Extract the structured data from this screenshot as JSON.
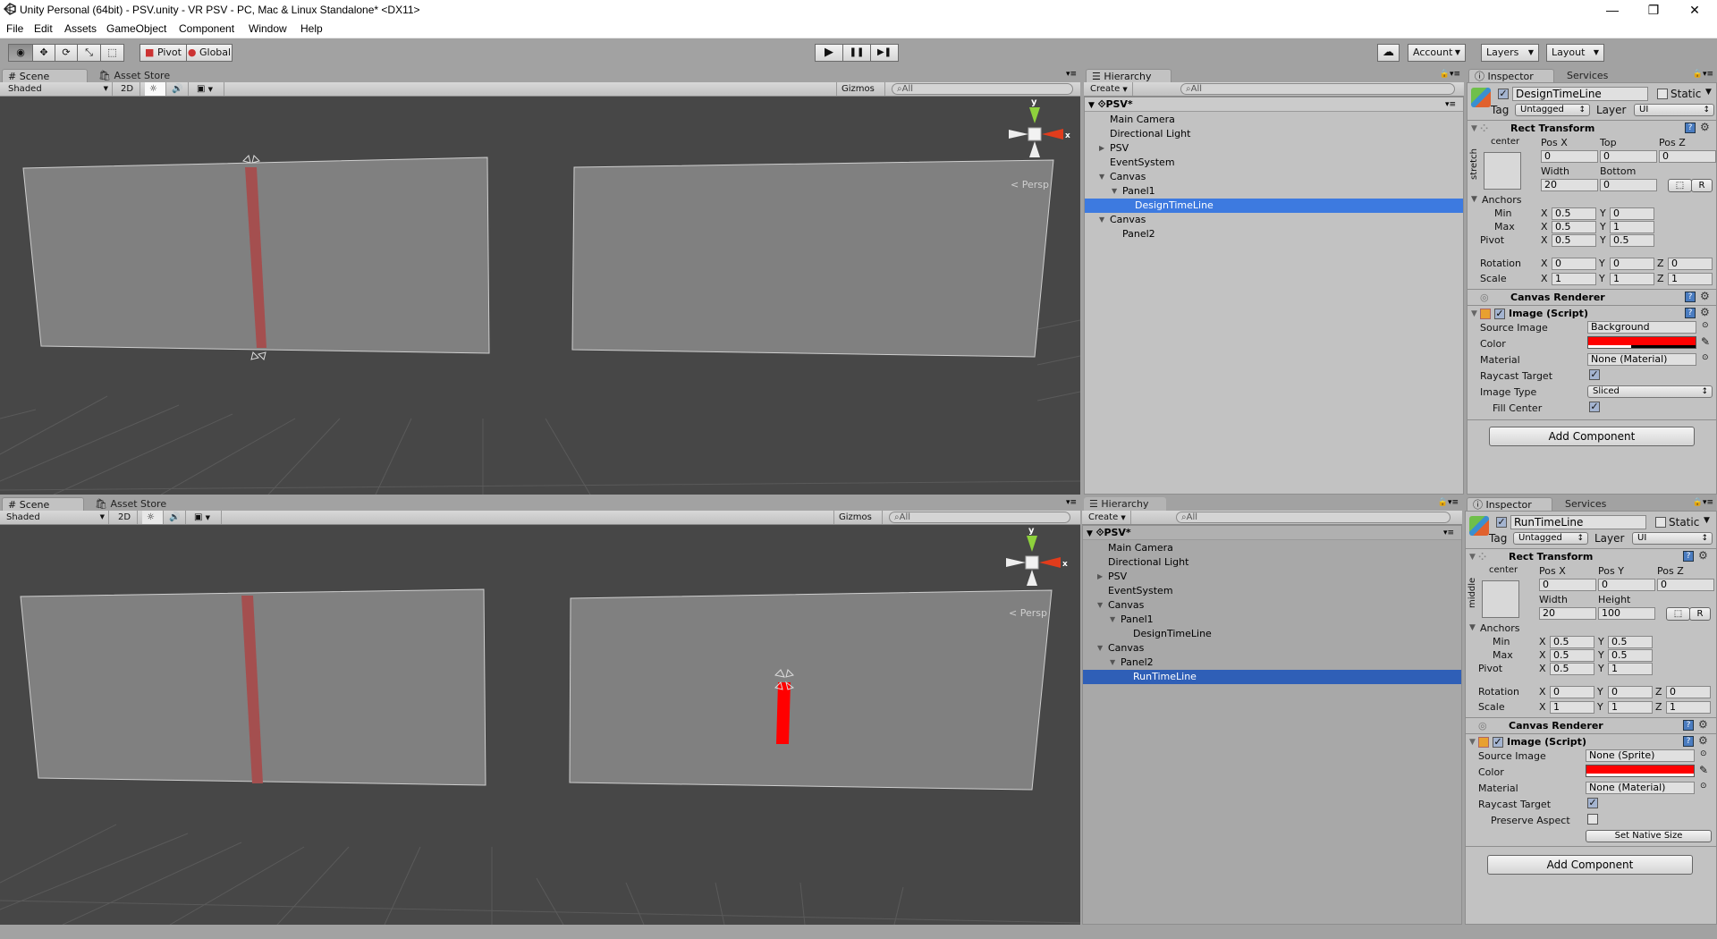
{
  "window": {
    "title": "Unity Personal (64bit) - PSV.unity - VR PSV - PC, Mac & Linux Standalone* <DX11>",
    "minimize_icon": "—",
    "maximize_icon": "❐",
    "close_icon": "✕"
  },
  "menu": [
    "File",
    "Edit",
    "Assets",
    "GameObject",
    "Component",
    "Window",
    "Help"
  ],
  "toolbar": {
    "tools": [
      "view-tool",
      "move-tool",
      "rotate-tool",
      "scale-tool",
      "rect-tool"
    ],
    "tool_glyphs": [
      "◉",
      "✥",
      "⟳",
      "⤡",
      "⬚"
    ],
    "pivot": "Pivot",
    "global": "Global",
    "play": "▶",
    "pause": "❚❚",
    "step": "▶❚",
    "collab_icon": "☁",
    "account": "Account",
    "layers": "Layers",
    "layout": "Layout"
  },
  "scene_panels": [
    {
      "tabs": [
        "Scene",
        "Asset Store"
      ],
      "shading": "Shaded",
      "mode_2d": "2D",
      "light_icon": "☼",
      "audio_icon": "🔊",
      "fx_icon": "▣",
      "gizmos": "Gizmos",
      "search_placeholder": "All",
      "persp_label": "Persp"
    },
    {
      "tabs": [
        "Scene",
        "Asset Store"
      ],
      "shading": "Shaded",
      "mode_2d": "2D",
      "light_icon": "☼",
      "audio_icon": "🔊",
      "fx_icon": "▣",
      "gizmos": "Gizmos",
      "search_placeholder": "All",
      "persp_label": "Persp"
    }
  ],
  "hierarchies": [
    {
      "tab": "Hierarchy",
      "create": "Create",
      "search_placeholder": "All",
      "scene": "PSV*",
      "rows": [
        {
          "label": "Main Camera",
          "depth": 0,
          "arrow": ""
        },
        {
          "label": "Directional Light",
          "depth": 0,
          "arrow": ""
        },
        {
          "label": "PSV",
          "depth": 0,
          "arrow": "▶"
        },
        {
          "label": "EventSystem",
          "depth": 0,
          "arrow": ""
        },
        {
          "label": "Canvas",
          "depth": 0,
          "arrow": "▼"
        },
        {
          "label": "Panel1",
          "depth": 1,
          "arrow": "▼"
        },
        {
          "label": "DesignTimeLine",
          "depth": 2,
          "arrow": "",
          "selected": true
        },
        {
          "label": "Canvas",
          "depth": 0,
          "arrow": "▼"
        },
        {
          "label": "Panel2",
          "depth": 1,
          "arrow": ""
        }
      ]
    },
    {
      "tab": "Hierarchy",
      "create": "Create",
      "search_placeholder": "All",
      "scene": "PSV*",
      "rows": [
        {
          "label": "Main Camera",
          "depth": 0,
          "arrow": ""
        },
        {
          "label": "Directional Light",
          "depth": 0,
          "arrow": ""
        },
        {
          "label": "PSV",
          "depth": 0,
          "arrow": "▶"
        },
        {
          "label": "EventSystem",
          "depth": 0,
          "arrow": ""
        },
        {
          "label": "Canvas",
          "depth": 0,
          "arrow": "▼"
        },
        {
          "label": "Panel1",
          "depth": 1,
          "arrow": "▼"
        },
        {
          "label": "DesignTimeLine",
          "depth": 2,
          "arrow": ""
        },
        {
          "label": "Canvas",
          "depth": 0,
          "arrow": "▼"
        },
        {
          "label": "Panel2",
          "depth": 1,
          "arrow": "▼"
        },
        {
          "label": "RunTimeLine",
          "depth": 2,
          "arrow": "",
          "selected": true
        }
      ]
    }
  ],
  "inspectors": [
    {
      "tabs": [
        "Inspector",
        "Services"
      ],
      "object_name": "DesignTimeLine",
      "active": true,
      "static_label": "Static",
      "static": false,
      "tag_label": "Tag",
      "tag": "Untagged",
      "layer_label": "Layer",
      "layer": "UI",
      "rect_transform": {
        "title": "Rect Transform",
        "anchor_h": "center",
        "anchor_v": "stretch",
        "headers": [
          "Pos X",
          "Top",
          "Pos Z"
        ],
        "values_row1": [
          "0",
          "0",
          "0"
        ],
        "headers2": [
          "Width",
          "Bottom"
        ],
        "values_row2": [
          "20",
          "0"
        ],
        "blueprint_btn": "⬚",
        "raw_btn": "R",
        "anchors_label": "Anchors",
        "min_label": "Min",
        "min": [
          "0.5",
          "0"
        ],
        "max_label": "Max",
        "max": [
          "0.5",
          "1"
        ],
        "pivot_label": "Pivot",
        "pivot": [
          "0.5",
          "0.5"
        ],
        "rotation_label": "Rotation",
        "rotation": [
          "0",
          "0",
          "0"
        ],
        "scale_label": "Scale",
        "scale": [
          "1",
          "1",
          "1"
        ]
      },
      "canvas_renderer": "Canvas Renderer",
      "image": {
        "title": "Image (Script)",
        "source_label": "Source Image",
        "source": "Background",
        "color_label": "Color",
        "color": "#ff0000",
        "alpha": 0.4,
        "material_label": "Material",
        "material": "None (Material)",
        "raycast_label": "Raycast Target",
        "raycast": true,
        "type_label": "Image Type",
        "type": "Sliced",
        "fill_label": "Fill Center",
        "fill": true
      },
      "add_component": "Add Component"
    },
    {
      "tabs": [
        "Inspector",
        "Services"
      ],
      "object_name": "RunTimeLine",
      "active": true,
      "static_label": "Static",
      "static": false,
      "tag_label": "Tag",
      "tag": "Untagged",
      "layer_label": "Layer",
      "layer": "UI",
      "rect_transform": {
        "title": "Rect Transform",
        "anchor_h": "center",
        "anchor_v": "middle",
        "headers": [
          "Pos X",
          "Pos Y",
          "Pos Z"
        ],
        "values_row1": [
          "0",
          "0",
          "0"
        ],
        "headers2": [
          "Width",
          "Height"
        ],
        "values_row2": [
          "20",
          "100"
        ],
        "blueprint_btn": "⬚",
        "raw_btn": "R",
        "anchors_label": "Anchors",
        "min_label": "Min",
        "min": [
          "0.5",
          "0.5"
        ],
        "max_label": "Max",
        "max": [
          "0.5",
          "0.5"
        ],
        "pivot_label": "Pivot",
        "pivot": [
          "0.5",
          "1"
        ],
        "rotation_label": "Rotation",
        "rotation": [
          "0",
          "0",
          "0"
        ],
        "scale_label": "Scale",
        "scale": [
          "1",
          "1",
          "1"
        ]
      },
      "canvas_renderer": "Canvas Renderer",
      "image": {
        "title": "Image (Script)",
        "source_label": "Source Image",
        "source": "None (Sprite)",
        "color_label": "Color",
        "color": "#ff0000",
        "alpha": 1.0,
        "material_label": "Material",
        "material": "None (Material)",
        "raycast_label": "Raycast Target",
        "raycast": true,
        "preserve_label": "Preserve Aspect",
        "preserve": false,
        "native_size": "Set Native Size"
      },
      "add_component": "Add Component"
    }
  ],
  "colors": {
    "selection": "#3d7ae0",
    "selection_inactive": "#2f5fb7",
    "design_line": "#a44f4f",
    "runtime_line": "#ff0000",
    "scene_bg": "#474747",
    "panel_fill": "#808080"
  }
}
